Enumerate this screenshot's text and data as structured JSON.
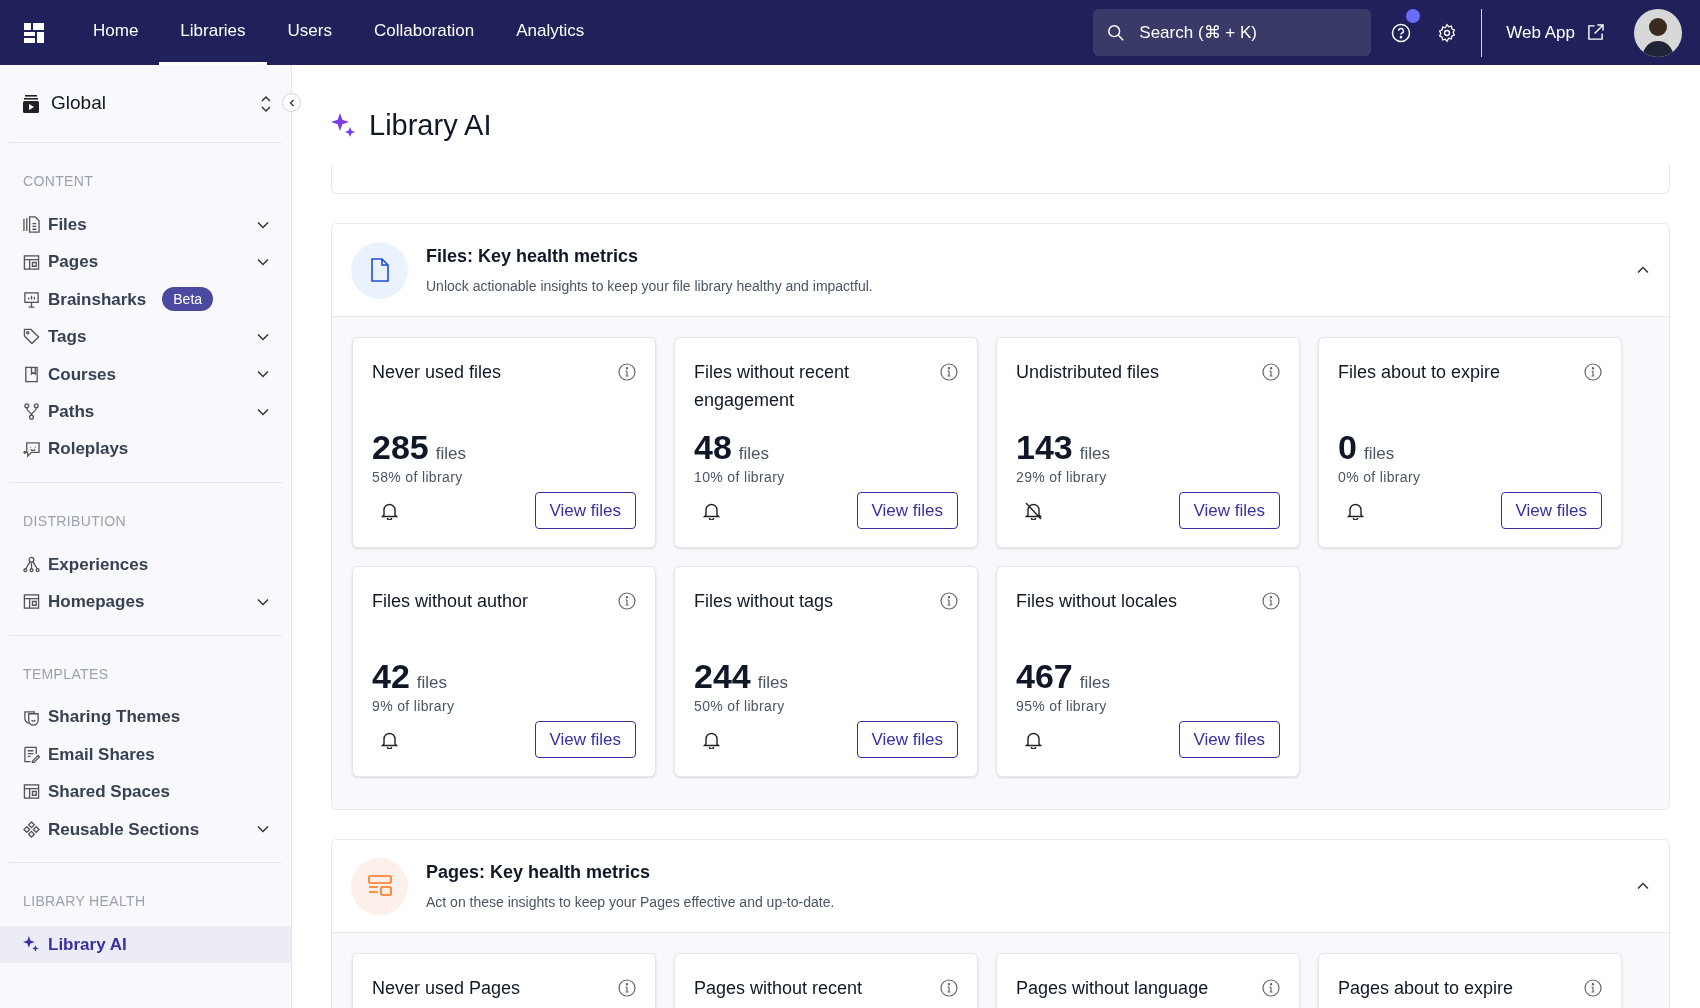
{
  "nav": {
    "tabs": [
      {
        "label": "Home",
        "selected": false
      },
      {
        "label": "Libraries",
        "selected": true
      },
      {
        "label": "Users",
        "selected": false
      },
      {
        "label": "Collaboration",
        "selected": false
      },
      {
        "label": "Analytics",
        "selected": false
      }
    ],
    "search": {
      "placeholder": "Search (⌘ + K)"
    },
    "help_notification": true,
    "web_app": "Web App"
  },
  "sidebar": {
    "scope": "Global",
    "sections": [
      {
        "heading": "CONTENT",
        "items": [
          {
            "label": "Files",
            "expandable": true,
            "selected": false
          },
          {
            "label": "Pages",
            "expandable": true,
            "selected": false
          },
          {
            "label": "Brainsharks",
            "expandable": false,
            "badge": "Beta",
            "selected": false
          },
          {
            "label": "Tags",
            "expandable": true,
            "selected": false
          },
          {
            "label": "Courses",
            "expandable": true,
            "selected": false
          },
          {
            "label": "Paths",
            "expandable": true,
            "selected": false
          },
          {
            "label": "Roleplays",
            "expandable": false,
            "selected": false
          }
        ]
      },
      {
        "heading": "DISTRIBUTION",
        "items": [
          {
            "label": "Experiences",
            "expandable": false,
            "selected": false
          },
          {
            "label": "Homepages",
            "expandable": true,
            "selected": false
          }
        ]
      },
      {
        "heading": "TEMPLATES",
        "items": [
          {
            "label": "Sharing Themes",
            "expandable": false,
            "selected": false
          },
          {
            "label": "Email Shares",
            "expandable": false,
            "selected": false
          },
          {
            "label": "Shared Spaces",
            "expandable": false,
            "selected": false
          },
          {
            "label": "Reusable Sections",
            "expandable": true,
            "selected": false
          }
        ]
      },
      {
        "heading": "LIBRARY HEALTH",
        "items": [
          {
            "label": "Library AI",
            "expandable": false,
            "selected": true
          }
        ]
      }
    ]
  },
  "page_title": "Library AI",
  "sections": [
    {
      "kind": "files",
      "title": "Files: Key health metrics",
      "subtitle": "Unlock actionable insights to keep your file library healthy and impactful.",
      "expanded": true,
      "cards": [
        {
          "title": "Never used files",
          "count": "285",
          "unit": "files",
          "share": "58% of library",
          "alerts_on": true,
          "action": "View files"
        },
        {
          "title": "Files without recent engagement",
          "count": "48",
          "unit": "files",
          "share": "10% of library",
          "alerts_on": true,
          "action": "View files"
        },
        {
          "title": "Undistributed files",
          "count": "143",
          "unit": "files",
          "share": "29% of library",
          "alerts_on": false,
          "action": "View files"
        },
        {
          "title": "Files about to expire",
          "count": "0",
          "unit": "files",
          "share": "0% of library",
          "alerts_on": true,
          "action": "View files"
        },
        {
          "title": "Files without author",
          "count": "42",
          "unit": "files",
          "share": "9% of library",
          "alerts_on": true,
          "action": "View files"
        },
        {
          "title": "Files without tags",
          "count": "244",
          "unit": "files",
          "share": "50% of library",
          "alerts_on": true,
          "action": "View files"
        },
        {
          "title": "Files without locales",
          "count": "467",
          "unit": "files",
          "share": "95% of library",
          "alerts_on": true,
          "action": "View files"
        }
      ]
    },
    {
      "kind": "pages",
      "title": "Pages: Key health metrics",
      "subtitle": "Act on these insights to keep your Pages effective and up-to-date.",
      "expanded": true,
      "cards": [
        {
          "title": "Never used Pages"
        },
        {
          "title": "Pages without recent"
        },
        {
          "title": "Pages without language"
        },
        {
          "title": "Pages about to expire"
        }
      ]
    }
  ]
}
